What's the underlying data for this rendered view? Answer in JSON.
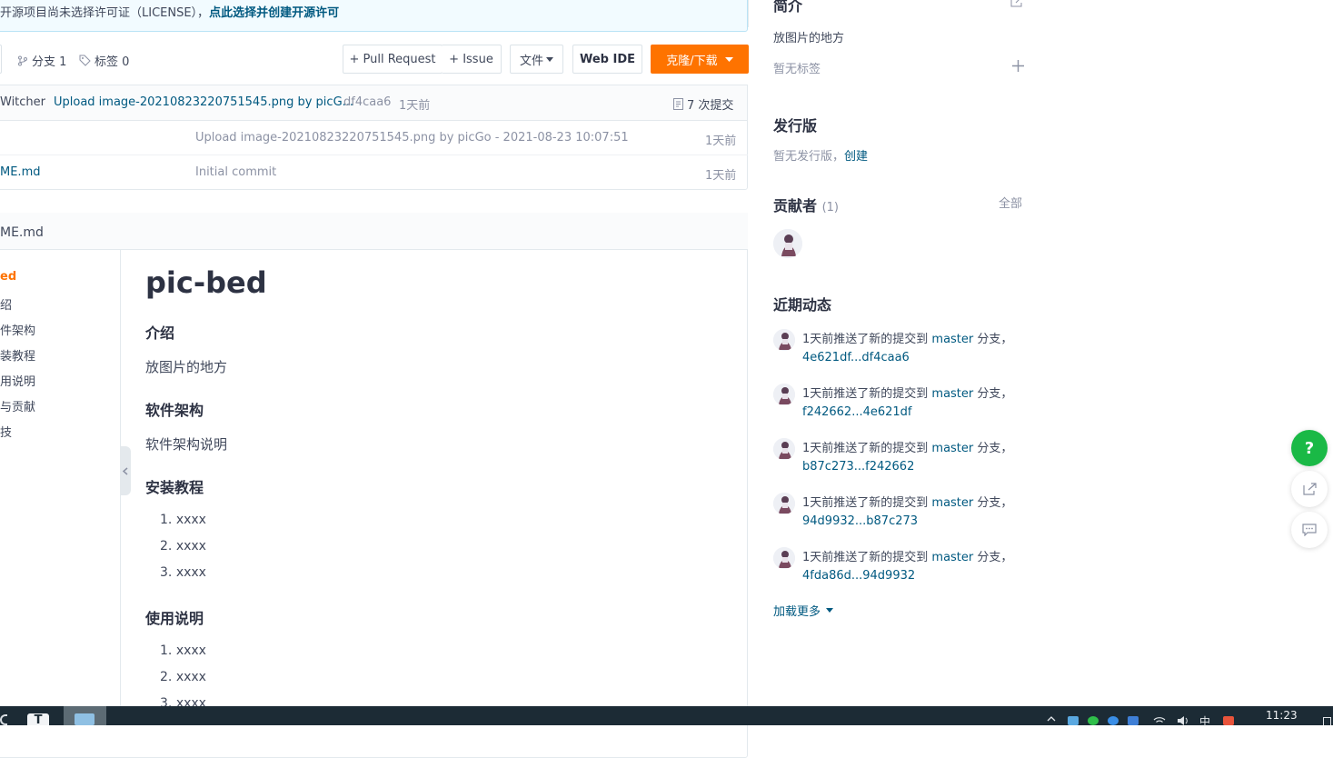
{
  "banner": {
    "text": "开源项目尚未选择许可证（LICENSE），",
    "link": "点此选择并创建开源许可"
  },
  "toolbar": {
    "branches": "分支 1",
    "tags": "标签 0",
    "pull_request": "+ Pull Request",
    "issue": "+ Issue",
    "file": "文件",
    "web_ide": "Web IDE",
    "clone": "克隆/下载"
  },
  "commit": {
    "author": "Witcher",
    "message": "Upload image-20210823220751545.png by picG...",
    "hash": "df4caa6",
    "time": "1天前",
    "count": "7 次提交"
  },
  "files": [
    {
      "name": "",
      "message": "Upload image-20210823220751545.png by picGo - 2021-08-23 10:07:51",
      "time": "1天前"
    },
    {
      "name": "ME.md",
      "message": "Initial commit",
      "time": "1天前"
    }
  ],
  "readme": {
    "filename": "ME.md",
    "toc": [
      "ed",
      "绍",
      "件架构",
      "装教程",
      "用说明",
      "与贡献",
      "技"
    ],
    "title": "pic-bed",
    "sections": {
      "intro_h": "介绍",
      "intro_p": "放图片的地方",
      "arch_h": "软件架构",
      "arch_p": "软件架构说明",
      "install_h": "安装教程",
      "install_items": [
        "xxxx",
        "xxxx",
        "xxxx"
      ],
      "usage_h": "使用说明",
      "usage_items": [
        "xxxx",
        "xxxx",
        "xxxx"
      ]
    }
  },
  "sidebar": {
    "intro_title": "简介",
    "intro_text": "放图片的地方",
    "no_tags": "暂无标签",
    "release_title": "发行版",
    "no_release": "暂无发行版，",
    "create": "创建",
    "contributors_title": "贡献者",
    "contributors_count": "(1)",
    "all": "全部",
    "activity_title": "近期动态",
    "activities": [
      {
        "prefix": "1天前推送了新的提交到 ",
        "branch": "master",
        "suffix": " 分支，",
        "range": "4e621df...df4caa6"
      },
      {
        "prefix": "1天前推送了新的提交到 ",
        "branch": "master",
        "suffix": " 分支，",
        "range": "f242662...4e621df"
      },
      {
        "prefix": "1天前推送了新的提交到 ",
        "branch": "master",
        "suffix": " 分支，",
        "range": "b87c273...f242662"
      },
      {
        "prefix": "1天前推送了新的提交到 ",
        "branch": "master",
        "suffix": " 分支，",
        "range": "94d9932...b87c273"
      },
      {
        "prefix": "1天前推送了新的提交到 ",
        "branch": "master",
        "suffix": " 分支，",
        "range": "4fda86d...94d9932"
      }
    ],
    "load_more": "加载更多"
  },
  "floating": {
    "help": "?"
  },
  "taskbar": {
    "ime": "中",
    "clock": "11:23"
  },
  "colors": {
    "accent": "#fe7300",
    "link": "#005980",
    "help_green": "#1ab946"
  }
}
